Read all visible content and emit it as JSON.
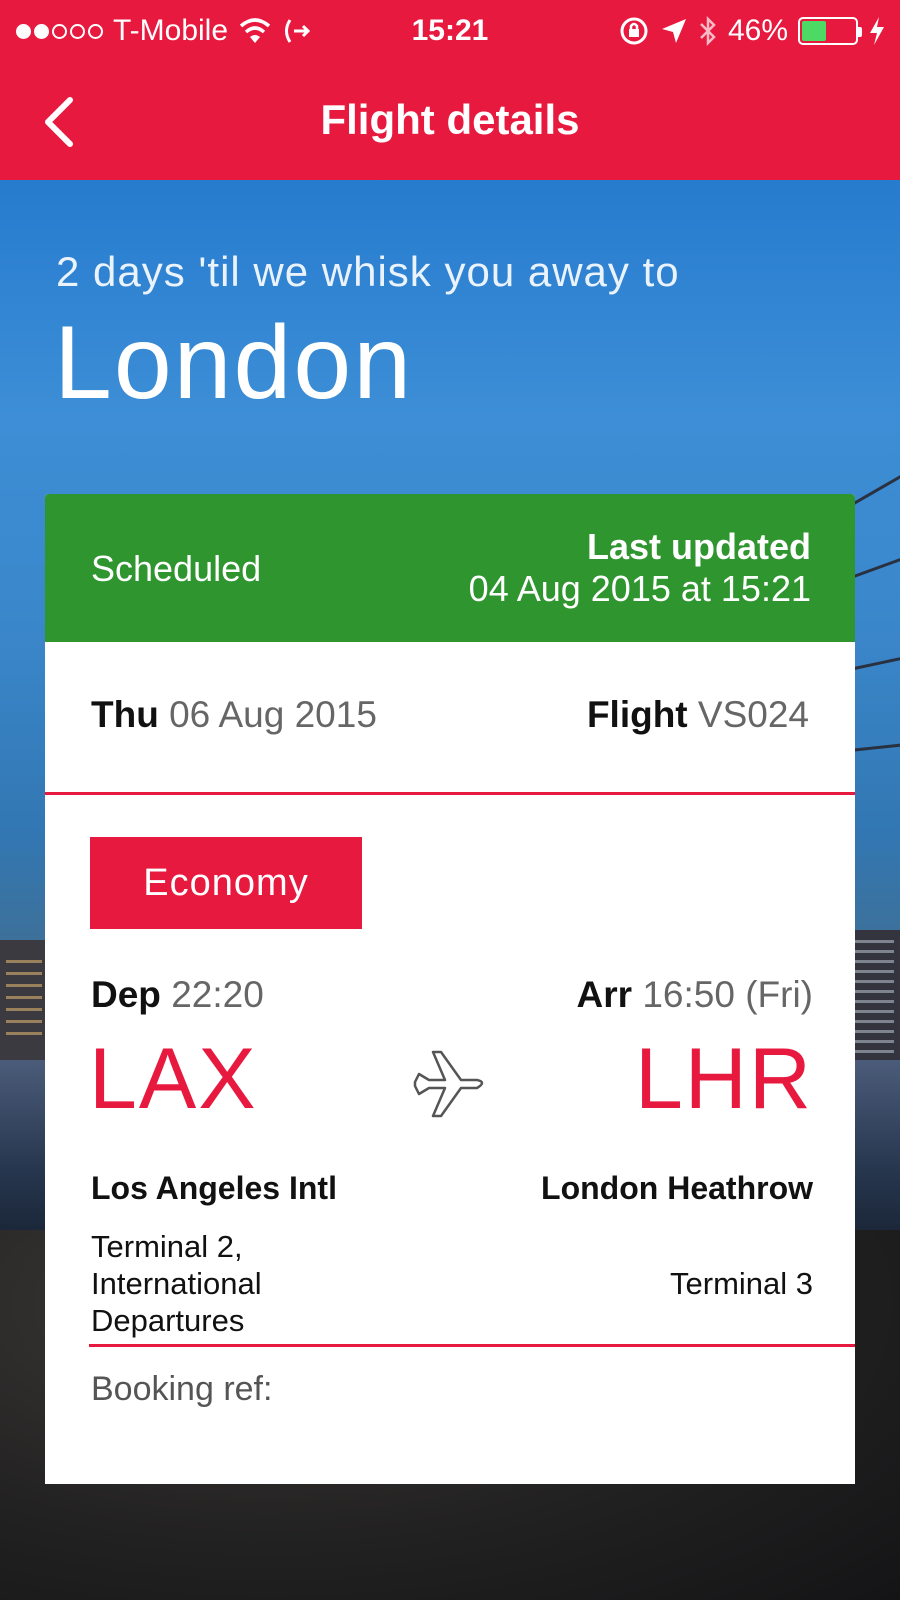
{
  "status_bar": {
    "carrier": "T-Mobile",
    "time": "15:21",
    "battery_percent": "46%",
    "battery_level": 0.46,
    "icons": [
      "signal-dots",
      "wifi-icon",
      "call-forward-icon",
      "orientation-lock-icon",
      "location-arrow-icon",
      "bluetooth-icon",
      "battery-icon",
      "charging-icon"
    ]
  },
  "nav": {
    "title": "Flight details",
    "back_icon": "chevron-left-icon"
  },
  "headline": {
    "countdown": "2 days 'til we whisk you away to",
    "destination": "London"
  },
  "flight_status": {
    "status": "Scheduled",
    "updated_label": "Last updated",
    "updated_value": "04 Aug 2015 at 15:21",
    "color": "#2f952f"
  },
  "flight": {
    "day": "Thu",
    "date": "06 Aug 2015",
    "flight_label": "Flight",
    "flight_number": "VS024",
    "cabin": "Economy",
    "departure": {
      "label": "Dep",
      "time": "22:20",
      "code": "LAX",
      "airport": "Los Angeles Intl",
      "terminal": "Terminal 2, International Departures"
    },
    "arrival": {
      "label": "Arr",
      "time": "16:50 (Fri)",
      "code": "LHR",
      "airport": "London Heathrow",
      "terminal": "Terminal 3"
    },
    "booking_ref_label": "Booking ref:"
  },
  "colors": {
    "brand": "#e8193f",
    "status_green": "#2f952f"
  }
}
